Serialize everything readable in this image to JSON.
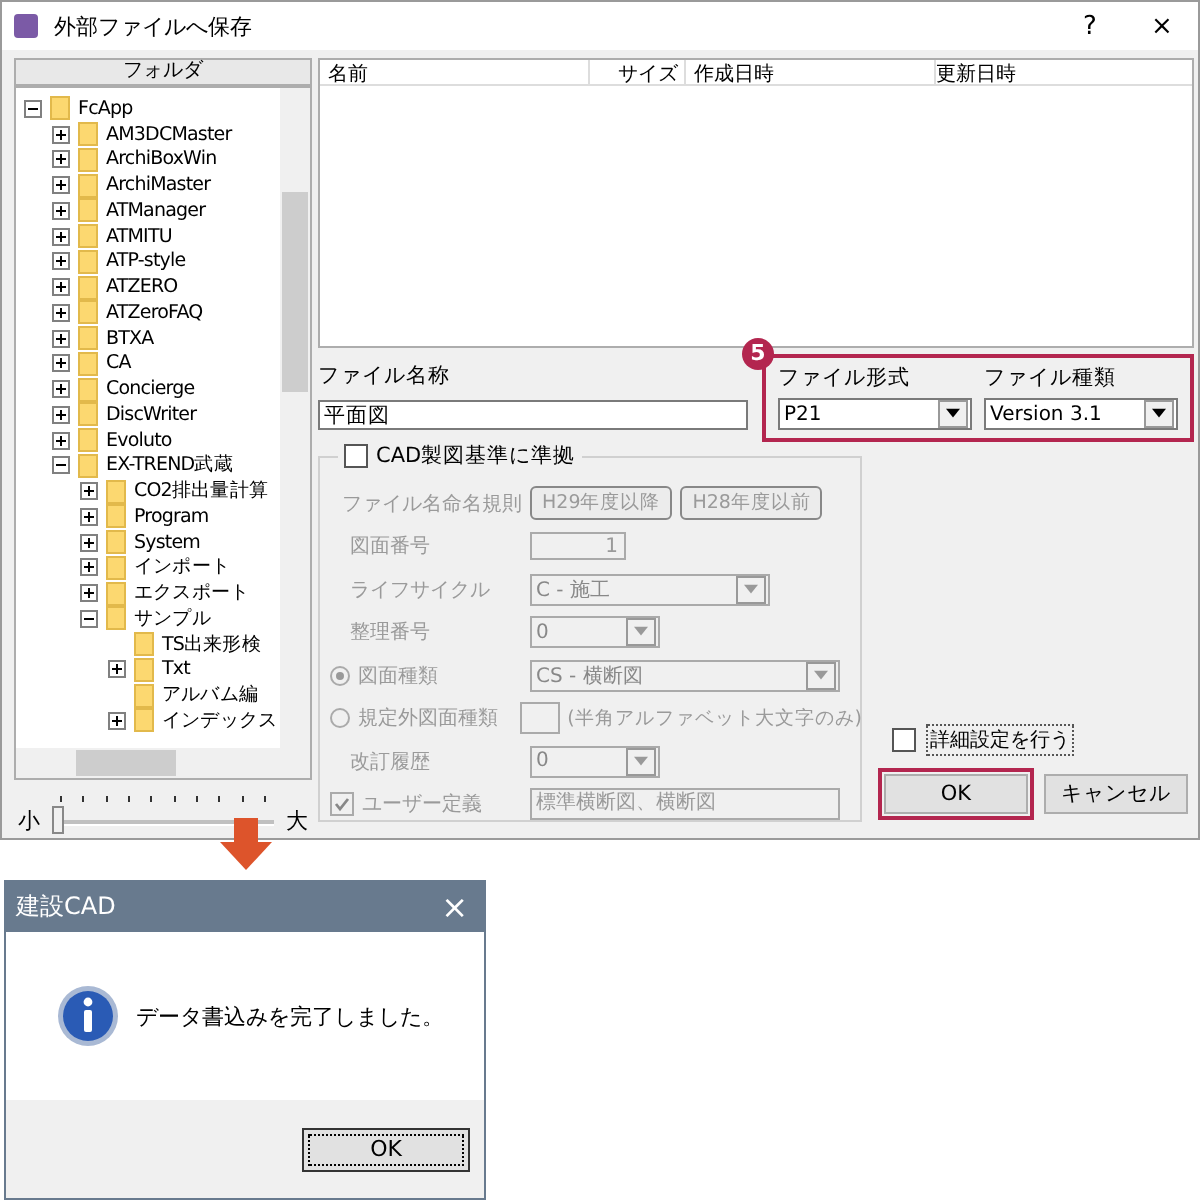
{
  "window": {
    "title": "外部ファイルへ保存",
    "help": "?",
    "close": "×"
  },
  "folder_panel": {
    "header": "フォルダ",
    "tree": [
      {
        "label": "FcApp",
        "expanded": true,
        "children": [
          {
            "label": "AM3DCMaster",
            "expanded": false
          },
          {
            "label": "ArchiBoxWin",
            "expanded": false
          },
          {
            "label": "ArchiMaster",
            "expanded": false
          },
          {
            "label": "ATManager",
            "expanded": false
          },
          {
            "label": "ATMITU",
            "expanded": false
          },
          {
            "label": "ATP-style",
            "expanded": false
          },
          {
            "label": "ATZERO",
            "expanded": false
          },
          {
            "label": "ATZeroFAQ",
            "expanded": false
          },
          {
            "label": "BTXA",
            "expanded": false
          },
          {
            "label": "CA",
            "expanded": false
          },
          {
            "label": "Concierge",
            "expanded": false
          },
          {
            "label": "DiscWriter",
            "expanded": false
          },
          {
            "label": "Evoluto",
            "expanded": false
          },
          {
            "label": "EX-TREND武蔵",
            "expanded": true,
            "children": [
              {
                "label": "CO2排出量計算",
                "expanded": false
              },
              {
                "label": "Program",
                "expanded": false
              },
              {
                "label": "System",
                "expanded": false
              },
              {
                "label": "インポート",
                "expanded": false
              },
              {
                "label": "エクスポート",
                "expanded": false
              },
              {
                "label": "サンプル",
                "expanded": true,
                "children": [
                  {
                    "label": "TS出来形検"
                  },
                  {
                    "label": "Txt",
                    "expanded": false
                  },
                  {
                    "label": "アルバム編"
                  },
                  {
                    "label": "インデックス",
                    "expanded": false
                  }
                ]
              }
            ]
          }
        ]
      }
    ],
    "size_slider": {
      "min_label": "小",
      "max_label": "大",
      "level": 0
    }
  },
  "file_list": {
    "columns": [
      "名前",
      "サイズ",
      "作成日時",
      "更新日時"
    ]
  },
  "file_name": {
    "label": "ファイル名称",
    "value": "平面図"
  },
  "step_badge": "5",
  "file_format": {
    "label": "ファイル形式",
    "value": "P21"
  },
  "file_type": {
    "label": "ファイル種類",
    "value": "Version 3.1"
  },
  "cad_standard": {
    "label": "CAD製図基準に準拠",
    "checked": false,
    "rows": [
      {
        "kind": "buttons",
        "label": "ファイル名命名規則",
        "buttons": [
          "H29年度以降",
          "H28年度以前"
        ]
      },
      {
        "kind": "number",
        "label": "図面番号",
        "value": "1"
      },
      {
        "kind": "wide-select",
        "label": "ライフサイクル",
        "value": "C - 施工"
      },
      {
        "kind": "select",
        "label": "整理番号",
        "value": "0"
      },
      {
        "kind": "radio-select",
        "label": "図面種類",
        "selected": true,
        "value": "CS - 横断図"
      },
      {
        "kind": "radio-text",
        "label": "規定外図面種類",
        "selected": false,
        "hint": "(半角アルファベット大文字のみ)"
      },
      {
        "kind": "select",
        "label": "改訂履歴",
        "value": "0"
      },
      {
        "kind": "check-text",
        "label": "ユーザー定義",
        "checked": true,
        "value": "標準横断図、横断図"
      }
    ]
  },
  "detail_settings": {
    "label": "詳細設定を行う",
    "checked": false
  },
  "buttons": [
    {
      "label": "OK",
      "highlighted": true
    },
    {
      "label": "キャンセル",
      "highlighted": false
    }
  ],
  "message_dialog": {
    "title": "建設CAD",
    "close": "×",
    "message": "データ書込みを完了しました。",
    "button": "OK"
  }
}
